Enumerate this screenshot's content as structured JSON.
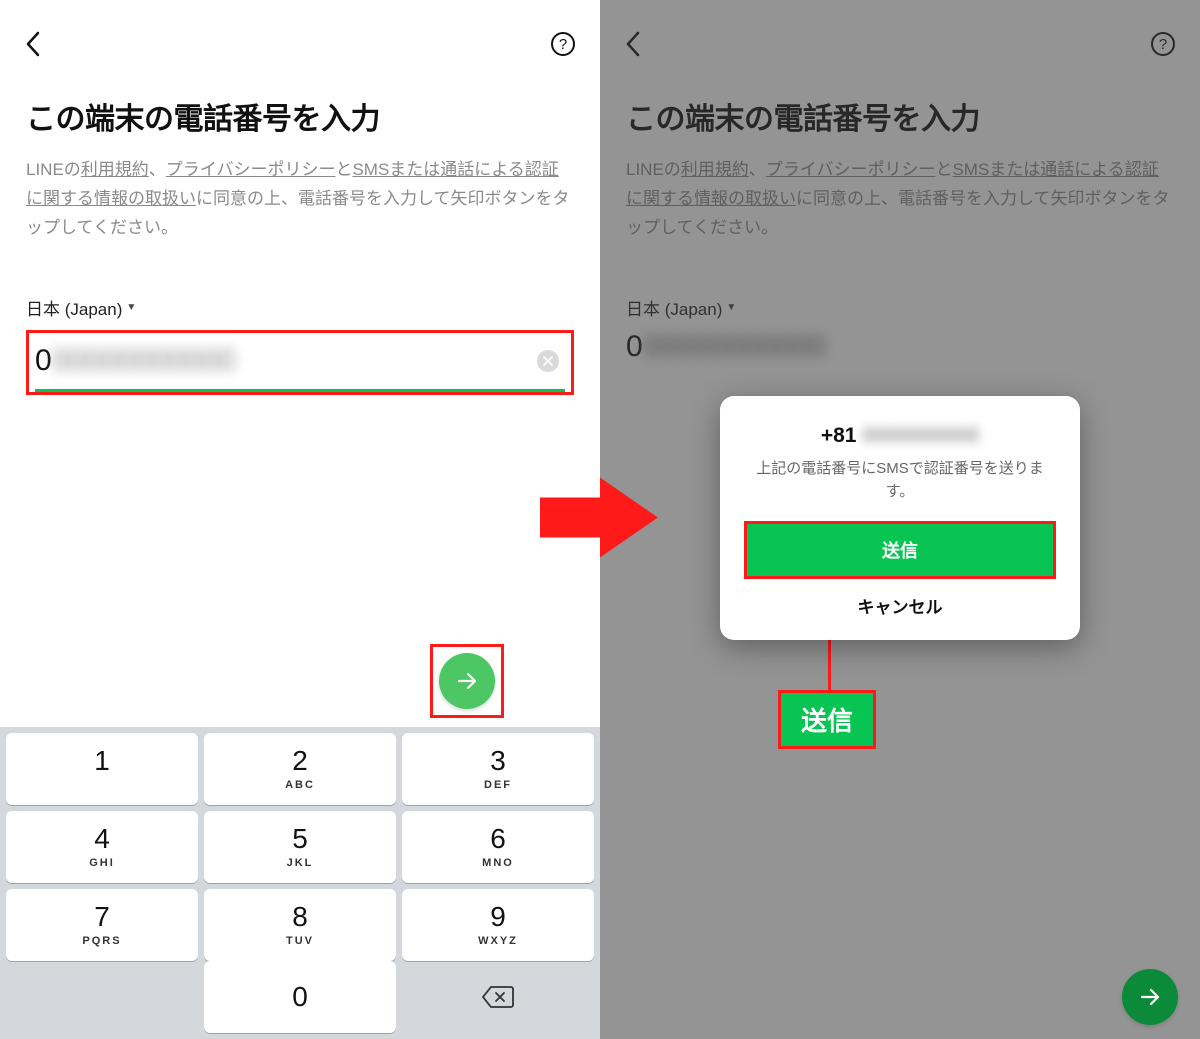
{
  "left": {
    "header_title": "この端末の電話番号を入力",
    "desc_prefix": "LINEの",
    "link_terms": "利用規約",
    "sep1": "、",
    "link_privacy": "プライバシーポリシー",
    "sep_and": "と",
    "link_sms": "SMSまたは通話による認証に関する情報の取扱い",
    "desc_suffix": "に同意の上、電話番号を入力して矢印ボタンをタップしてください。",
    "country_label": "日本 (Japan)",
    "phone_visible": "0",
    "phone_blur": "00000000000"
  },
  "right": {
    "header_title": "この端末の電話番号を入力",
    "desc_prefix": "LINEの",
    "link_terms": "利用規約",
    "sep1": "、",
    "link_privacy": "プライバシーポリシー",
    "sep_and": "と",
    "link_sms": "SMSまたは通話による認証に関する情報の取扱い",
    "desc_suffix": "に同意の上、電話番号を入力して矢印ボタンをタップしてください。",
    "country_label": "日本 (Japan)",
    "phone_visible": "0",
    "phone_blur": "00000000000"
  },
  "dialog": {
    "prefix": "+81",
    "blur": "0000000000",
    "message": "上記の電話番号にSMSで認証番号を送ります。",
    "send": "送信",
    "cancel": "キャンセル"
  },
  "callout": {
    "label": "送信"
  },
  "keypad": {
    "keys": [
      [
        {
          "n": "1",
          "s": ""
        },
        {
          "n": "2",
          "s": "ABC"
        },
        {
          "n": "3",
          "s": "DEF"
        }
      ],
      [
        {
          "n": "4",
          "s": "GHI"
        },
        {
          "n": "5",
          "s": "JKL"
        },
        {
          "n": "6",
          "s": "MNO"
        }
      ],
      [
        {
          "n": "7",
          "s": "PQRS"
        },
        {
          "n": "8",
          "s": "TUV"
        },
        {
          "n": "9",
          "s": "WXYZ"
        }
      ]
    ],
    "zero": "0"
  },
  "colors": {
    "accent": "#08c453",
    "annotation": "#ff1a1a"
  }
}
